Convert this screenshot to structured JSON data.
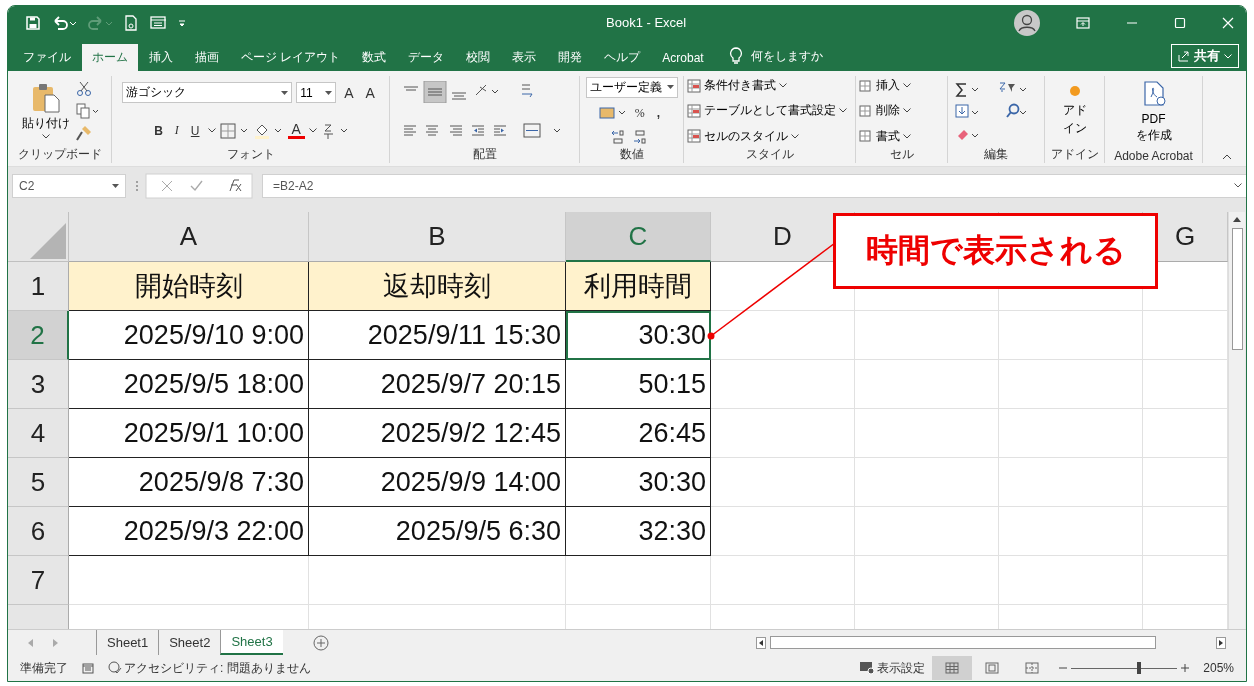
{
  "window": {
    "title": "Book1  -  Excel"
  },
  "menu_tabs": [
    {
      "label": "ファイル",
      "selected": false
    },
    {
      "label": "ホーム",
      "selected": true
    },
    {
      "label": "挿入",
      "selected": false
    },
    {
      "label": "描画",
      "selected": false
    },
    {
      "label": "ページ レイアウト",
      "selected": false
    },
    {
      "label": "数式",
      "selected": false
    },
    {
      "label": "データ",
      "selected": false
    },
    {
      "label": "校閲",
      "selected": false
    },
    {
      "label": "表示",
      "selected": false
    },
    {
      "label": "開発",
      "selected": false
    },
    {
      "label": "ヘルプ",
      "selected": false
    },
    {
      "label": "Acrobat",
      "selected": false
    }
  ],
  "tell_me": {
    "placeholder": "何をしますか"
  },
  "share_button": {
    "label": "共有"
  },
  "ribbon": {
    "clipboard": {
      "paste": "貼り付け",
      "label": "クリップボード"
    },
    "font": {
      "name": "游ゴシック",
      "size": "11",
      "grow": "A",
      "shrink": "A",
      "bold": "B",
      "italic": "I",
      "underline": "U",
      "color_letter": "A",
      "label": "フォント"
    },
    "alignment": {
      "label": "配置"
    },
    "number": {
      "format": "ユーザー定義",
      "percent": "%",
      "comma": ",",
      "label": "数値"
    },
    "styles": {
      "items": [
        "条件付き書式",
        "テーブルとして書式設定",
        "セルのスタイル"
      ],
      "label": "スタイル"
    },
    "cells": {
      "items": [
        "挿入",
        "削除",
        "書式"
      ],
      "label": "セル"
    },
    "editing": {
      "label": "編集"
    },
    "addins": {
      "button": [
        "アド",
        "イン"
      ],
      "label": "アドイン"
    },
    "acrobat": {
      "button": [
        "PDF",
        "を作成"
      ],
      "label": "Adobe Acrobat"
    }
  },
  "formula_bar": {
    "name_box": "C2",
    "formula": "=B2-A2"
  },
  "sheet": {
    "columns": [
      {
        "label": "A",
        "selected": false
      },
      {
        "label": "B",
        "selected": false
      },
      {
        "label": "C",
        "selected": true
      },
      {
        "label": "D",
        "selected": false
      },
      {
        "label": "G",
        "selected": false
      }
    ],
    "rows": [
      {
        "header": "1",
        "selected": false,
        "kind": "heading",
        "cells": [
          "開始時刻",
          "返却時刻",
          "利用時間"
        ]
      },
      {
        "header": "2",
        "selected": true,
        "kind": "data",
        "cells": [
          "2025/9/10 9:00",
          "2025/9/11 15:30",
          "30:30"
        ]
      },
      {
        "header": "3",
        "selected": false,
        "kind": "data",
        "cells": [
          "2025/9/5 18:00",
          "2025/9/7 20:15",
          "50:15"
        ]
      },
      {
        "header": "4",
        "selected": false,
        "kind": "data",
        "cells": [
          "2025/9/1 10:00",
          "2025/9/2 12:45",
          "26:45"
        ]
      },
      {
        "header": "5",
        "selected": false,
        "kind": "data",
        "cells": [
          "2025/9/8 7:30",
          "2025/9/9 14:00",
          "30:30"
        ]
      },
      {
        "header": "6",
        "selected": false,
        "kind": "data",
        "cells": [
          "2025/9/3 22:00",
          "2025/9/5 6:30",
          "32:30"
        ]
      },
      {
        "header": "7",
        "selected": false
      }
    ]
  },
  "callout": {
    "text": "時間で表示される"
  },
  "sheet_tabs": [
    {
      "label": "Sheet1",
      "selected": false
    },
    {
      "label": "Sheet2",
      "selected": false
    },
    {
      "label": "Sheet3",
      "selected": true
    }
  ],
  "status_bar": {
    "ready": "準備完了",
    "accessibility": "アクセシビリティ: 問題ありません",
    "display_settings": "表示設定",
    "views": [
      {
        "selected": true
      },
      {
        "selected": false
      },
      {
        "selected": false
      }
    ],
    "zoom": "205%",
    "level": 0.62
  }
}
